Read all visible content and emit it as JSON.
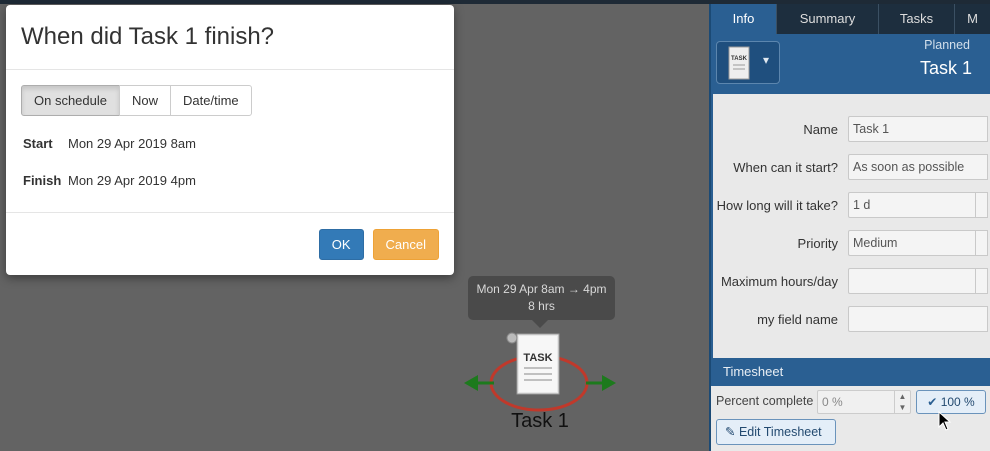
{
  "dialog": {
    "title": "When did Task 1 finish?",
    "options": [
      "On schedule",
      "Now",
      "Date/time"
    ],
    "start_label": "Start",
    "start_value": "Mon 29 Apr 2019 8am",
    "finish_label": "Finish",
    "finish_value": "Mon 29 Apr 2019 4pm",
    "ok_label": "OK",
    "cancel_label": "Cancel"
  },
  "canvas": {
    "tooltip_line1": "Mon 29 Apr 8am → 4pm",
    "tooltip_line2": "8 hrs",
    "task_label": "Task 1",
    "task_icon_text": "TASK"
  },
  "panel": {
    "tabs": [
      "Info",
      "Summary",
      "Tasks",
      "M"
    ],
    "status": "Planned",
    "title": "Task 1",
    "fields": [
      {
        "label": "Name",
        "value": "Task 1"
      },
      {
        "label": "When can it start?",
        "value": "As soon as possible"
      },
      {
        "label": "How long will it take?",
        "value": "1 d"
      },
      {
        "label": "Priority",
        "value": "Medium"
      },
      {
        "label": "Maximum hours/day",
        "value": ""
      },
      {
        "label": "my field name",
        "value": ""
      }
    ],
    "timesheet_title": "Timesheet",
    "percent_label": "Percent complete",
    "percent_value": "0 %",
    "percent_button": "100 %",
    "edit_button": "Edit Timesheet"
  },
  "colors": {
    "primary": "#337ab7",
    "warning": "#f0ad4e",
    "panel_blue": "#2a5f92",
    "arrow_green": "#1d7a1d",
    "ellipse_red": "#c0392b"
  }
}
